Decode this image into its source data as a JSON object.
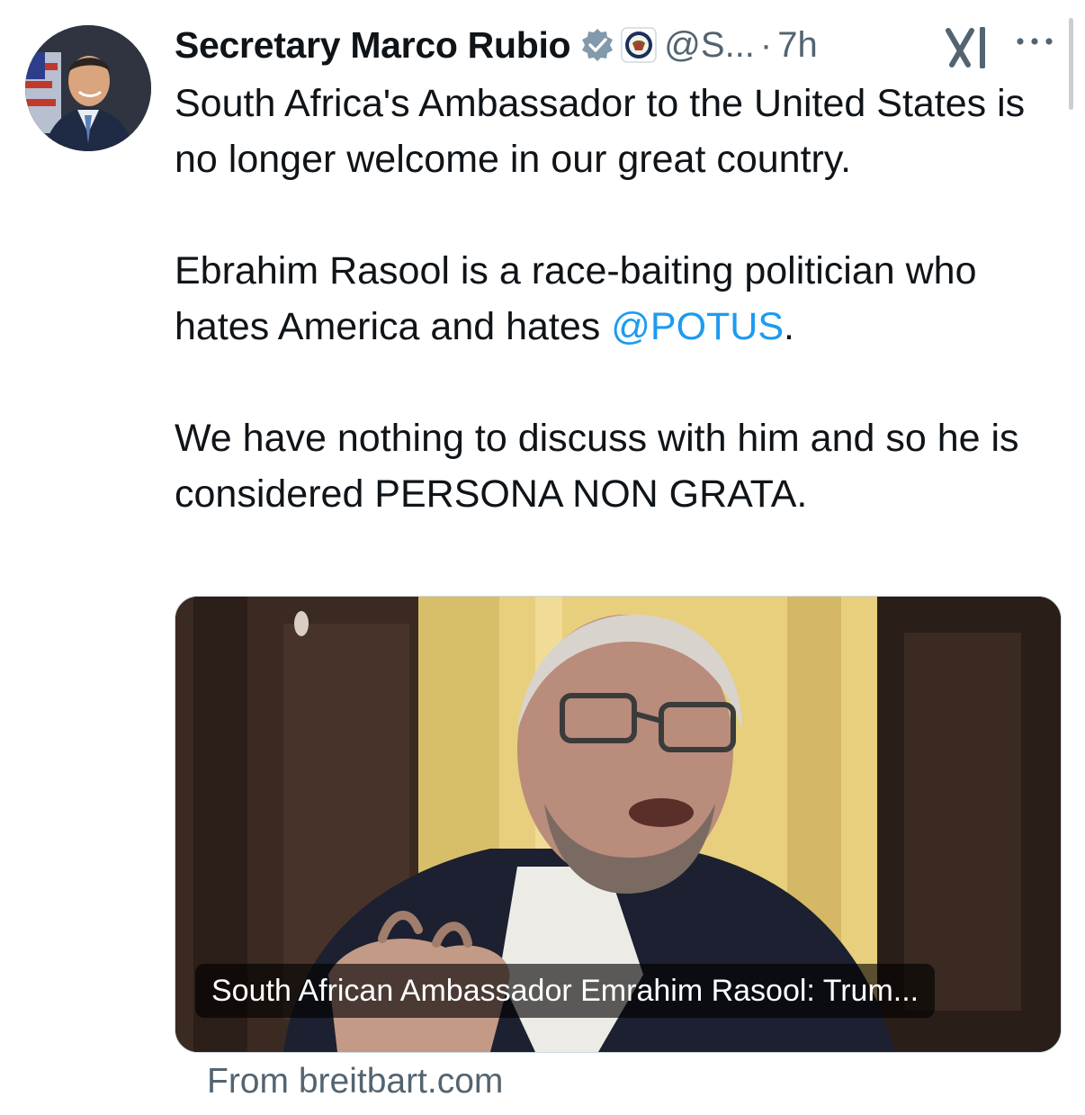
{
  "author": {
    "display_name": "Secretary Marco Rubio",
    "handle": "@S...",
    "separator": "·",
    "time": "7h"
  },
  "icons": {
    "verified": "verified-badge-icon",
    "org_badge": "department-of-state-seal-icon",
    "grok": "grok-icon",
    "more": "more-options-icon"
  },
  "colors": {
    "text": "#0f1419",
    "secondary": "#536471",
    "link": "#1d9bf0",
    "verified_badge": "#829aab"
  },
  "tweet": {
    "paragraph1": "South Africa's Ambassador to the United States is no longer welcome in our great country.",
    "paragraph2_before": "Ebrahim Rasool is a race-baiting politician who hates America and hates ",
    "paragraph2_mention": "@POTUS",
    "paragraph2_after": ".",
    "paragraph3": "We have nothing to discuss with him and so he is considered PERSONA NON GRATA."
  },
  "card": {
    "caption": "South African Ambassador Emrahim Rasool: Trum...",
    "source": "From breitbart.com"
  }
}
